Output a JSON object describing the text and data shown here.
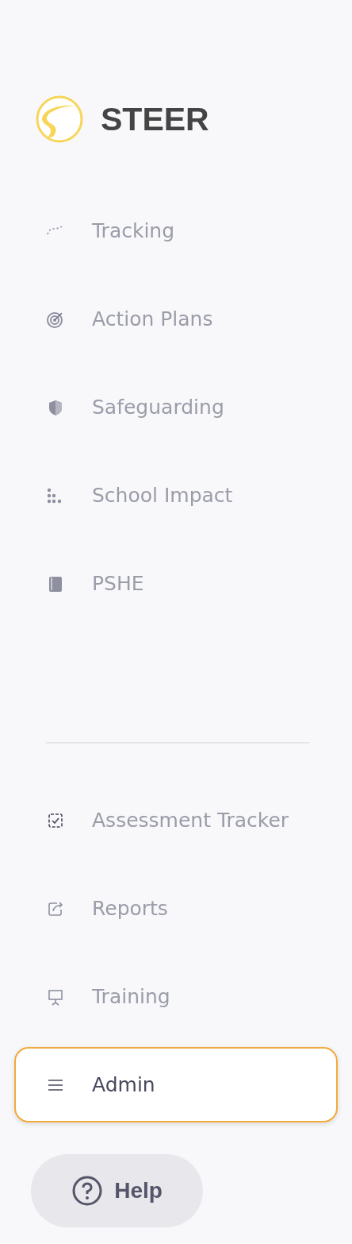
{
  "logo": {
    "name": "STEER"
  },
  "nav_main": [
    {
      "label": "Tracking",
      "selected": false
    },
    {
      "label": "Action Plans",
      "selected": false
    },
    {
      "label": "Safeguarding",
      "selected": false
    },
    {
      "label": "School Impact",
      "selected": false
    },
    {
      "label": "PSHE",
      "selected": false
    }
  ],
  "nav_secondary": [
    {
      "label": "Assessment Tracker",
      "selected": false
    },
    {
      "label": "Reports",
      "selected": false
    },
    {
      "label": "Training",
      "selected": false
    },
    {
      "label": "Admin",
      "selected": true
    }
  ],
  "help_button": {
    "label": "Help"
  }
}
